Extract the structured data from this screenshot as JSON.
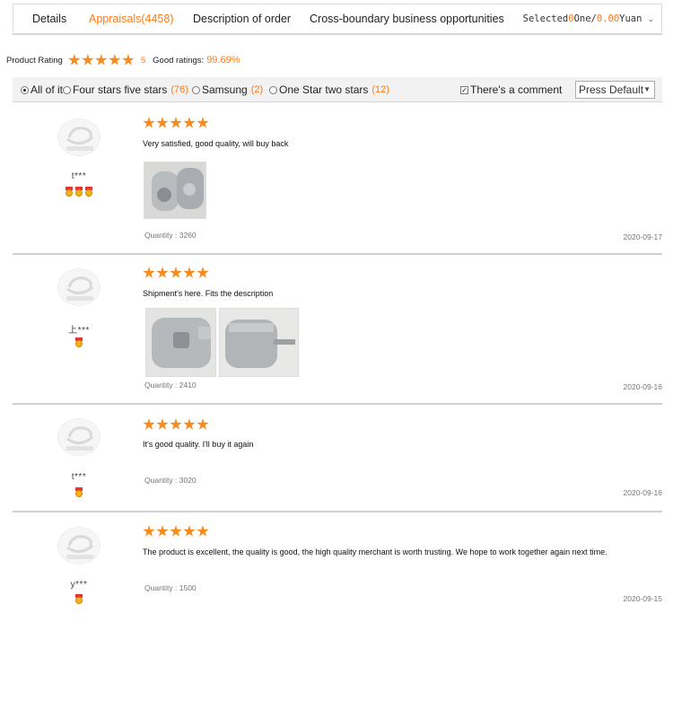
{
  "tabs": [
    {
      "label": "Details",
      "active": false
    },
    {
      "label": "Appraisals(4458)",
      "active": true
    },
    {
      "label": "Description of order",
      "active": false
    },
    {
      "label": "Cross-boundary business opportunities",
      "active": false
    }
  ],
  "cart": {
    "prefix": "Selected",
    "count": "0",
    "unit": "One/",
    "amount": "0.00",
    "currency": "Yuan"
  },
  "rating": {
    "label": "Product Rating",
    "stars": 5,
    "score": "5",
    "good_label": "Good ratings:",
    "good_value": "99.69%"
  },
  "filters": {
    "options": [
      {
        "label": "All of it",
        "count": "",
        "selected": true
      },
      {
        "label": "Four stars five stars",
        "count": "(76)",
        "selected": false
      },
      {
        "label": "Samsung",
        "count": "(2)",
        "selected": false
      },
      {
        "label": "One Star two stars",
        "count": "(12)",
        "selected": false
      }
    ],
    "comment_checkbox": {
      "label": "There's a comment",
      "checked": true
    },
    "sort": {
      "selected": "Press Default"
    }
  },
  "reviews": [
    {
      "user": "t***",
      "medals": 3,
      "stars": 5,
      "text": "Very satisfied, good quality, will buy back",
      "photos": 1,
      "quantity": "Quantity : 3260",
      "date": "2020-09-17"
    },
    {
      "user": "上***",
      "medals": 1,
      "stars": 5,
      "text": "Shipment's here. Fits the description",
      "photos": 2,
      "quantity": "Quantity : 2410",
      "date": "2020-09-16"
    },
    {
      "user": "t***",
      "medals": 1,
      "stars": 5,
      "text": "It's good quality. I'll buy it again",
      "photos": 0,
      "quantity": "Quantity : 3020",
      "date": "2020-09-16"
    },
    {
      "user": "y***",
      "medals": 1,
      "stars": 5,
      "text": "The product is excellent, the quality is good, the high quality merchant is worth trusting. We hope to work together again next time.",
      "photos": 0,
      "quantity": "Quantity : 1500",
      "date": "2020-09-15"
    }
  ],
  "colors": {
    "accent": "#ff7a1a",
    "star": "#f98a1d",
    "medal_gold": "#f4b21b",
    "medal_ribbon": "#e8352f"
  }
}
